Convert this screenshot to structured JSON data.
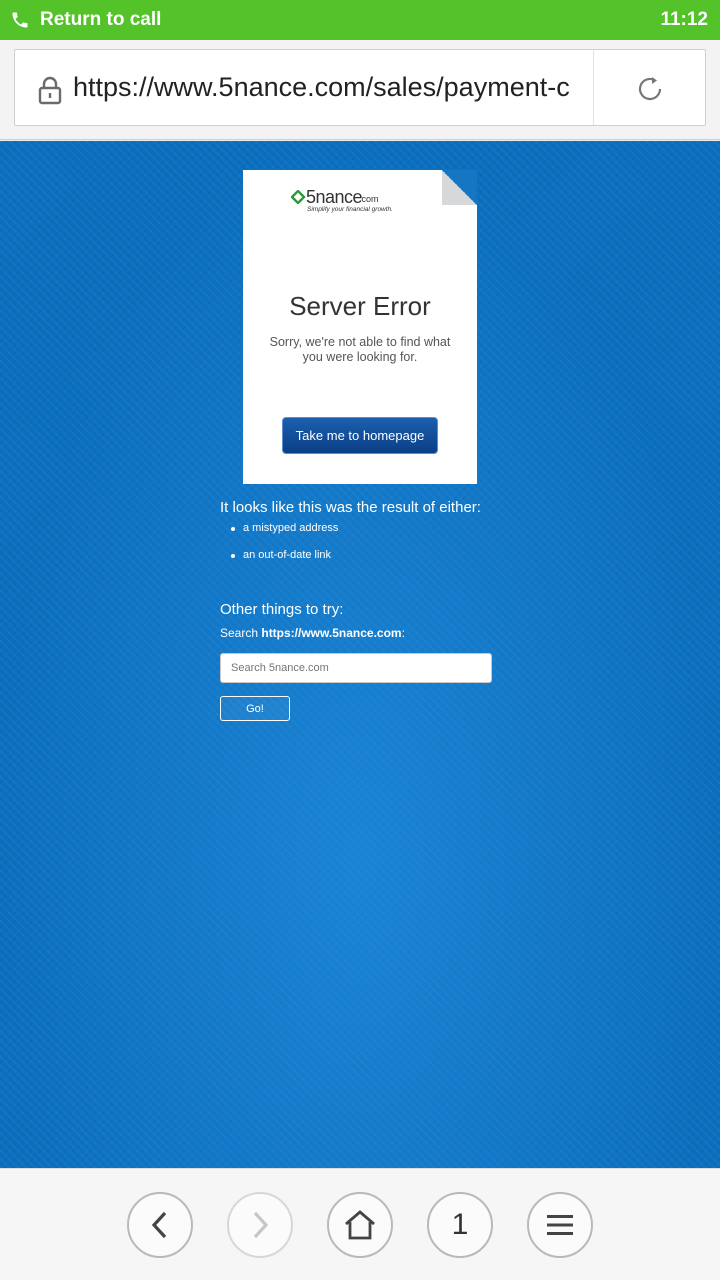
{
  "status_bar": {
    "return_label": "Return to call",
    "time": "11:12",
    "color": "#54c32a"
  },
  "browser": {
    "url": "https://www.5nance.com/sales/payment-c",
    "tab_count": "1"
  },
  "error_page": {
    "logo_brand": "5nance",
    "logo_com": ".com",
    "logo_tagline": "Simplify your financial growth.",
    "title": "Server Error",
    "message": "Sorry, we're not able to find what you were looking for.",
    "homepage_button": "Take me to homepage",
    "result_heading": "It looks like this was the result of either:",
    "causes": [
      "a mistyped address",
      "an out-of-date link"
    ],
    "other_heading": "Other things to try:",
    "search_prefix": "Search ",
    "search_site": "https://www.5nance.com",
    "search_suffix": ":",
    "search_placeholder": "Search 5nance.com",
    "go_button": "Go!"
  },
  "colors": {
    "background": "#0b6fc0",
    "button": "#0b3f86"
  }
}
